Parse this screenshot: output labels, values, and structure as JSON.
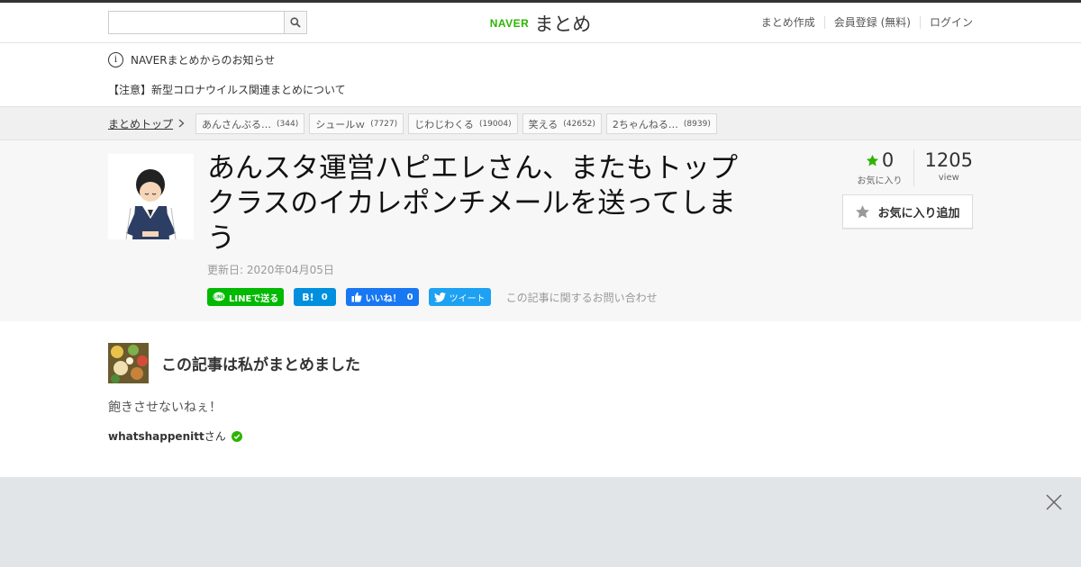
{
  "header": {
    "search_placeholder": "",
    "logo_brand": "NAVER",
    "logo_text": "まとめ",
    "nav": [
      "まとめ作成",
      "会員登録 (無料)",
      "ログイン"
    ]
  },
  "notice": {
    "info_icon": "i",
    "title": "NAVERまとめからのお知らせ",
    "message": "【注意】新型コロナウイルス関連まとめについて"
  },
  "breadcrumb": {
    "home": "まとめトップ",
    "tags": [
      {
        "label": "あんさんぶる…",
        "count": "(344)"
      },
      {
        "label": "シュールｗ",
        "count": "(7727)"
      },
      {
        "label": "じわじわくる",
        "count": "(19004)"
      },
      {
        "label": "笑える",
        "count": "(42652)"
      },
      {
        "label": "2ちゃんねる…",
        "count": "(8939)"
      }
    ]
  },
  "article": {
    "title": "あんスタ運営ハピエレさん、またもトップクラスのイカレポンチメールを送ってしまう",
    "updated": "更新日: 2020年04月05日",
    "share": {
      "line": "LINEで送る",
      "hatena_count": "0",
      "hatena_icon": "B!",
      "fb_label": "いいね！",
      "fb_count": "0",
      "tweet": "ツイート"
    },
    "inquiry": "この記事に関するお問い合わせ",
    "favorites_count": "0",
    "favorites_label": "お気に入り",
    "views": "1205",
    "views_label": "view",
    "add_favorite": "お気に入り追加"
  },
  "author": {
    "heading": "この記事は私がまとめました",
    "description": "飽きさせないねぇ！",
    "username": "whatshappenitt",
    "suffix": "さん"
  },
  "colors": {
    "naver_green": "#2db400",
    "line_green": "#00b900",
    "hatena_blue": "#008fde",
    "facebook_blue": "#1877f2",
    "twitter_blue": "#1da1f2"
  }
}
